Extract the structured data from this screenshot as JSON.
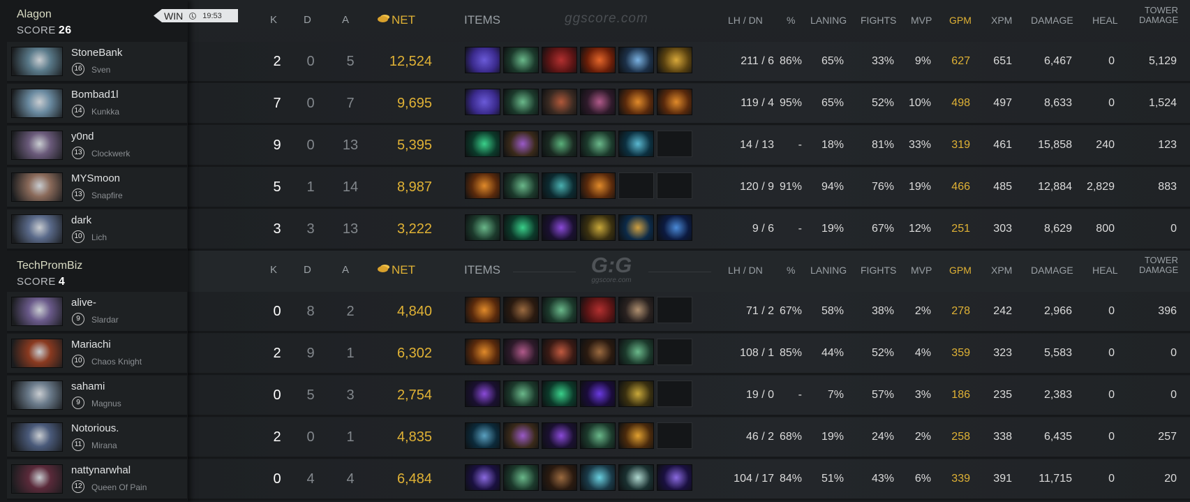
{
  "headers": {
    "k": "K",
    "d": "D",
    "a": "A",
    "net": "NET",
    "items": "ITEMS",
    "lh_dn": "LH / DN",
    "pct": "%",
    "laning": "LANING",
    "fights": "FIGHTS",
    "mvp": "MVP",
    "gpm": "GPM",
    "xpm": "XPM",
    "damage": "DAMAGE",
    "heal": "HEAL",
    "tower_damage_1": "TOWER",
    "tower_damage_2": "DAMAGE"
  },
  "watermark": {
    "top": "ggscore.com",
    "bottom_logo": "G:G",
    "bottom_small": "ggscore.com"
  },
  "colors": {
    "gold": "#e0b235",
    "background": "#1f2225",
    "panel": "#17191b"
  },
  "teams": [
    {
      "name": "Alagon",
      "score_label": "SCORE",
      "score": "26",
      "result": "WIN",
      "duration": "19:53",
      "players": [
        {
          "name": "StoneBank",
          "level": "16",
          "hero": "Sven",
          "k": "2",
          "d": "0",
          "a": "5",
          "net": "12,524",
          "lh_dn": "211 / 6",
          "pct": "86%",
          "laning": "65%",
          "fights": "33%",
          "mvp": "9%",
          "gpm": "627",
          "xpm": "651",
          "damage": "6,467",
          "heal": "0",
          "tower": "5,129",
          "items": [
            {
              "icon": "purple-cloak-item",
              "c1": "#3a2a8c",
              "c2": "#6a5ad8"
            },
            {
              "icon": "green-staff-item",
              "c1": "#1c3a2c",
              "c2": "#6ab88a"
            },
            {
              "icon": "red-helm-item",
              "c1": "#5a1414",
              "c2": "#b23030"
            },
            {
              "icon": "fire-orb-item",
              "c1": "#6a1e08",
              "c2": "#e4662a"
            },
            {
              "icon": "blue-scepter-item",
              "c1": "#1c3048",
              "c2": "#7ab2e2"
            },
            {
              "icon": "golden-helm-item",
              "c1": "#5a4210",
              "c2": "#d8a83a"
            }
          ]
        },
        {
          "name": "Bombad1l",
          "level": "14",
          "hero": "Kunkka",
          "k": "7",
          "d": "0",
          "a": "7",
          "net": "9,695",
          "lh_dn": "119 / 4",
          "pct": "95%",
          "laning": "65%",
          "fights": "52%",
          "mvp": "10%",
          "gpm": "498",
          "xpm": "497",
          "damage": "8,633",
          "heal": "0",
          "tower": "1,524",
          "items": [
            {
              "icon": "purple-cloak-item",
              "c1": "#3a2a8c",
              "c2": "#6a5ad8"
            },
            {
              "icon": "green-staff-item",
              "c1": "#1c3a2c",
              "c2": "#6ab88a"
            },
            {
              "icon": "armor-item",
              "c1": "#3a2a22",
              "c2": "#b0583a"
            },
            {
              "icon": "crossbow-item",
              "c1": "#2e1a2a",
              "c2": "#b05a8a"
            },
            {
              "icon": "orange-bracer-item",
              "c1": "#5a2a0c",
              "c2": "#e08a2a"
            },
            {
              "icon": "orange-bracer-item",
              "c1": "#5a2a0c",
              "c2": "#e08a2a"
            }
          ]
        },
        {
          "name": "y0nd",
          "level": "13",
          "hero": "Clockwerk",
          "k": "9",
          "d": "0",
          "a": "13",
          "net": "5,395",
          "lh_dn": "14 / 13",
          "pct": "-",
          "laning": "18%",
          "fights": "81%",
          "mvp": "33%",
          "gpm": "319",
          "xpm": "461",
          "damage": "15,858",
          "heal": "240",
          "tower": "123",
          "items": [
            {
              "icon": "green-boots-item",
              "c1": "#0c3a2a",
              "c2": "#3ad08a"
            },
            {
              "icon": "purple-mage-item",
              "c1": "#3a2a1a",
              "c2": "#9a5ac8"
            },
            {
              "icon": "green-blade-item",
              "c1": "#1a2a22",
              "c2": "#5ab07a"
            },
            {
              "icon": "green-staff-item",
              "c1": "#1c3a2c",
              "c2": "#6ab88a"
            },
            {
              "icon": "wave-orb-item",
              "c1": "#0c3040",
              "c2": "#5ab8d0"
            },
            {
              "icon": "empty-slot",
              "c1": "",
              "c2": ""
            }
          ]
        },
        {
          "name": "MYSmoon",
          "level": "13",
          "hero": "Snapfire",
          "k": "5",
          "d": "1",
          "a": "14",
          "net": "8,987",
          "lh_dn": "120 / 9",
          "pct": "91%",
          "laning": "94%",
          "fights": "76%",
          "mvp": "19%",
          "gpm": "466",
          "xpm": "485",
          "damage": "12,884",
          "heal": "2,829",
          "tower": "883",
          "items": [
            {
              "icon": "orange-bracer-item",
              "c1": "#5a2a0c",
              "c2": "#e08a2a"
            },
            {
              "icon": "green-staff-item",
              "c1": "#1c3a2c",
              "c2": "#6ab88a"
            },
            {
              "icon": "teal-boots-item",
              "c1": "#0c2a30",
              "c2": "#4ab0b0"
            },
            {
              "icon": "orange-bracer-item",
              "c1": "#5a2a0c",
              "c2": "#e08a2a"
            },
            {
              "icon": "empty-slot",
              "c1": "",
              "c2": ""
            },
            {
              "icon": "empty-slot",
              "c1": "",
              "c2": ""
            }
          ]
        },
        {
          "name": "dark",
          "level": "10",
          "hero": "Lich",
          "k": "3",
          "d": "3",
          "a": "13",
          "net": "3,222",
          "lh_dn": "9 / 6",
          "pct": "-",
          "laning": "19%",
          "fights": "67%",
          "mvp": "12%",
          "gpm": "251",
          "xpm": "303",
          "damage": "8,629",
          "heal": "800",
          "tower": "0",
          "items": [
            {
              "icon": "green-staff-item",
              "c1": "#1c3a2c",
              "c2": "#6ab88a"
            },
            {
              "icon": "green-boots-item",
              "c1": "#0c3a2a",
              "c2": "#3ad08a"
            },
            {
              "icon": "purple-orb-item",
              "c1": "#1a1030",
              "c2": "#8a4ad8"
            },
            {
              "icon": "gold-trinket-item",
              "c1": "#3a3010",
              "c2": "#c8a83a"
            },
            {
              "icon": "eye-amulet-item",
              "c1": "#0c2a48",
              "c2": "#d0a040"
            },
            {
              "icon": "mana-potion-item",
              "c1": "#0c1a40",
              "c2": "#4a8ad8"
            }
          ]
        }
      ]
    },
    {
      "name": "TechPromBiz",
      "score_label": "SCORE",
      "score": "4",
      "players": [
        {
          "name": "alive-",
          "level": "9",
          "hero": "Slardar",
          "k": "0",
          "d": "8",
          "a": "2",
          "net": "4,840",
          "lh_dn": "71 / 2",
          "pct": "67%",
          "laning": "58%",
          "fights": "38%",
          "mvp": "2%",
          "gpm": "278",
          "xpm": "242",
          "damage": "2,966",
          "heal": "0",
          "tower": "396",
          "items": [
            {
              "icon": "orange-bracer-item",
              "c1": "#5a2a0c",
              "c2": "#e08a2a"
            },
            {
              "icon": "brown-boots-item",
              "c1": "#2a1a10",
              "c2": "#9a6a40"
            },
            {
              "icon": "green-staff-item",
              "c1": "#1c3a2c",
              "c2": "#6ab88a"
            },
            {
              "icon": "red-helm-item",
              "c1": "#5a1414",
              "c2": "#b23030"
            },
            {
              "icon": "battle-axe-item",
              "c1": "#2a2220",
              "c2": "#b09070"
            },
            {
              "icon": "empty-slot",
              "c1": "",
              "c2": ""
            }
          ]
        },
        {
          "name": "Mariachi",
          "level": "10",
          "hero": "Chaos Knight",
          "k": "2",
          "d": "9",
          "a": "1",
          "net": "6,302",
          "lh_dn": "108 / 1",
          "pct": "85%",
          "laning": "44%",
          "fights": "52%",
          "mvp": "4%",
          "gpm": "359",
          "xpm": "323",
          "damage": "5,583",
          "heal": "0",
          "tower": "0",
          "items": [
            {
              "icon": "orange-bracer-item",
              "c1": "#5a2a0c",
              "c2": "#e08a2a"
            },
            {
              "icon": "crossbow-item",
              "c1": "#2e1a2a",
              "c2": "#b05a8a"
            },
            {
              "icon": "red-axe-item",
              "c1": "#3a1a14",
              "c2": "#c05a40"
            },
            {
              "icon": "brown-boots-item",
              "c1": "#2a1a10",
              "c2": "#9a6a40"
            },
            {
              "icon": "green-staff-item",
              "c1": "#1c3a2c",
              "c2": "#6ab88a"
            },
            {
              "icon": "empty-slot",
              "c1": "",
              "c2": ""
            }
          ]
        },
        {
          "name": "sahami",
          "level": "9",
          "hero": "Magnus",
          "k": "0",
          "d": "5",
          "a": "3",
          "net": "2,754",
          "lh_dn": "19 / 0",
          "pct": "-",
          "laning": "7%",
          "fights": "57%",
          "mvp": "3%",
          "gpm": "186",
          "xpm": "235",
          "damage": "2,383",
          "heal": "0",
          "tower": "0",
          "items": [
            {
              "icon": "purple-orb-item",
              "c1": "#1a1030",
              "c2": "#8a4ad8"
            },
            {
              "icon": "green-staff-item",
              "c1": "#1c3a2c",
              "c2": "#6ab88a"
            },
            {
              "icon": "green-boots-item",
              "c1": "#0c3a2a",
              "c2": "#3ad08a"
            },
            {
              "icon": "purple-ring-item",
              "c1": "#1a0c3a",
              "c2": "#6a3ae0"
            },
            {
              "icon": "gold-trinket-item",
              "c1": "#3a3010",
              "c2": "#c8a83a"
            },
            {
              "icon": "empty-slot",
              "c1": "",
              "c2": ""
            }
          ]
        },
        {
          "name": "Notorious.",
          "level": "11",
          "hero": "Mirana",
          "k": "2",
          "d": "0",
          "a": "1",
          "net": "4,835",
          "lh_dn": "46 / 2",
          "pct": "68%",
          "laning": "19%",
          "fights": "24%",
          "mvp": "2%",
          "gpm": "258",
          "xpm": "338",
          "damage": "6,435",
          "heal": "0",
          "tower": "257",
          "items": [
            {
              "icon": "teal-bottle-item",
              "c1": "#0c2a3a",
              "c2": "#5aa0c0"
            },
            {
              "icon": "purple-mage-item",
              "c1": "#3a2a1a",
              "c2": "#9a5ac8"
            },
            {
              "icon": "purple-orb-item",
              "c1": "#1a1030",
              "c2": "#8a4ad8"
            },
            {
              "icon": "green-staff-item",
              "c1": "#1c3a2c",
              "c2": "#6ab88a"
            },
            {
              "icon": "gold-charm-item",
              "c1": "#4a2a0c",
              "c2": "#e0a030"
            },
            {
              "icon": "empty-slot",
              "c1": "",
              "c2": ""
            }
          ]
        },
        {
          "name": "nattynarwhal",
          "level": "12",
          "hero": "Queen Of Pain",
          "k": "0",
          "d": "4",
          "a": "4",
          "net": "6,484",
          "lh_dn": "104 / 17",
          "pct": "84%",
          "laning": "51%",
          "fights": "43%",
          "mvp": "6%",
          "gpm": "339",
          "xpm": "391",
          "damage": "11,715",
          "heal": "0",
          "tower": "20",
          "items": [
            {
              "icon": "purple-blade-item",
              "c1": "#1a1040",
              "c2": "#8a6ae0"
            },
            {
              "icon": "green-staff-item",
              "c1": "#1c3a2c",
              "c2": "#6ab88a"
            },
            {
              "icon": "brown-boots-item",
              "c1": "#2a1a10",
              "c2": "#9a6a40"
            },
            {
              "icon": "blue-crystal-item",
              "c1": "#1a3a48",
              "c2": "#6ad0e0"
            },
            {
              "icon": "white-wind-item",
              "c1": "#1a3030",
              "c2": "#b0d8d0"
            },
            {
              "icon": "purple-blade-item",
              "c1": "#1a1040",
              "c2": "#8a6ae0"
            }
          ]
        }
      ]
    }
  ]
}
